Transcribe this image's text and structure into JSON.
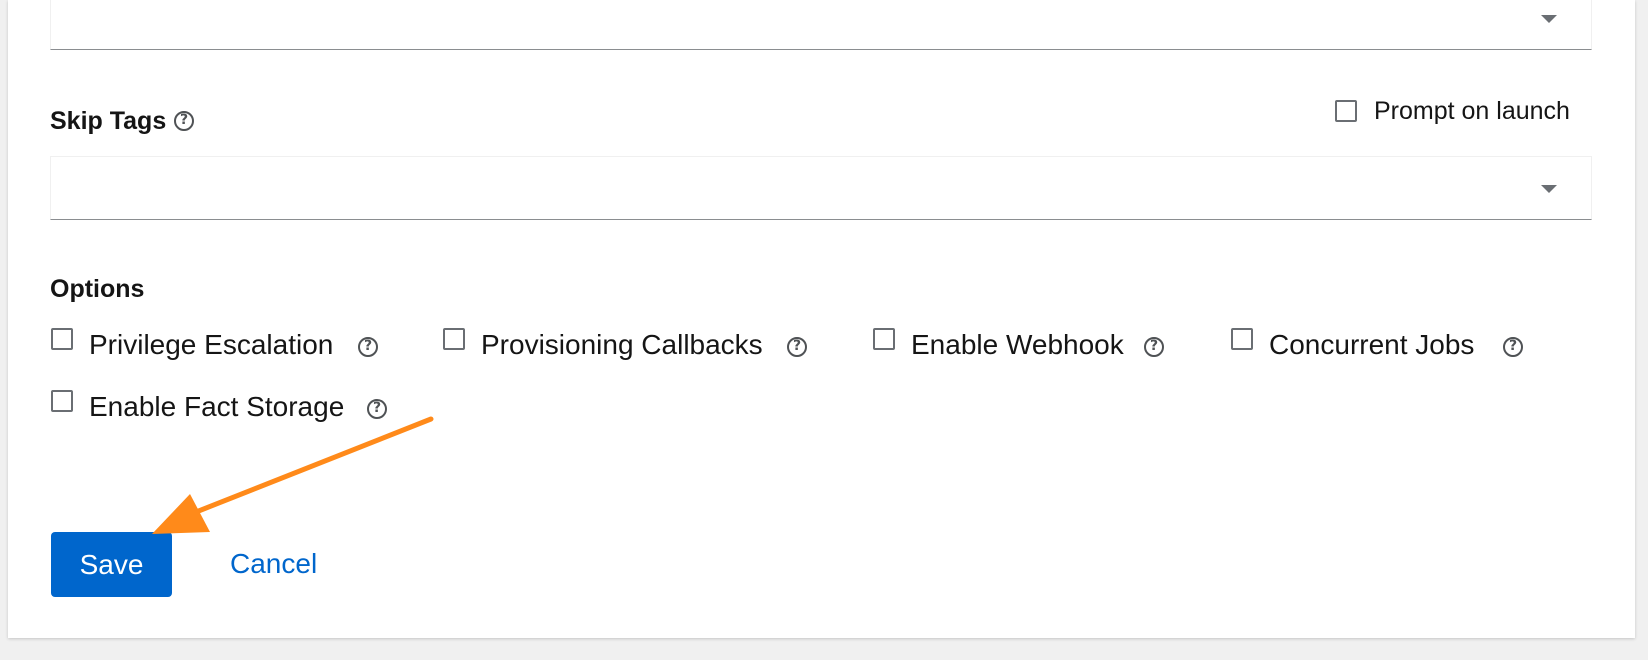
{
  "skip_tags": {
    "label": "Skip Tags",
    "prompt_on_launch_label": "Prompt on launch",
    "prompt_on_launch_checked": false
  },
  "options": {
    "heading": "Options",
    "items": [
      {
        "label": "Privilege Escalation",
        "checked": false
      },
      {
        "label": "Provisioning Callbacks",
        "checked": false
      },
      {
        "label": "Enable Webhook",
        "checked": false
      },
      {
        "label": "Concurrent Jobs",
        "checked": false
      },
      {
        "label": "Enable Fact Storage",
        "checked": false
      }
    ]
  },
  "actions": {
    "save_label": "Save",
    "cancel_label": "Cancel"
  },
  "icons": {
    "help": "question-circle-icon",
    "caret": "caret-down-icon"
  },
  "colors": {
    "primary": "#0066cc",
    "annotation_arrow": "#ff8a1a"
  }
}
